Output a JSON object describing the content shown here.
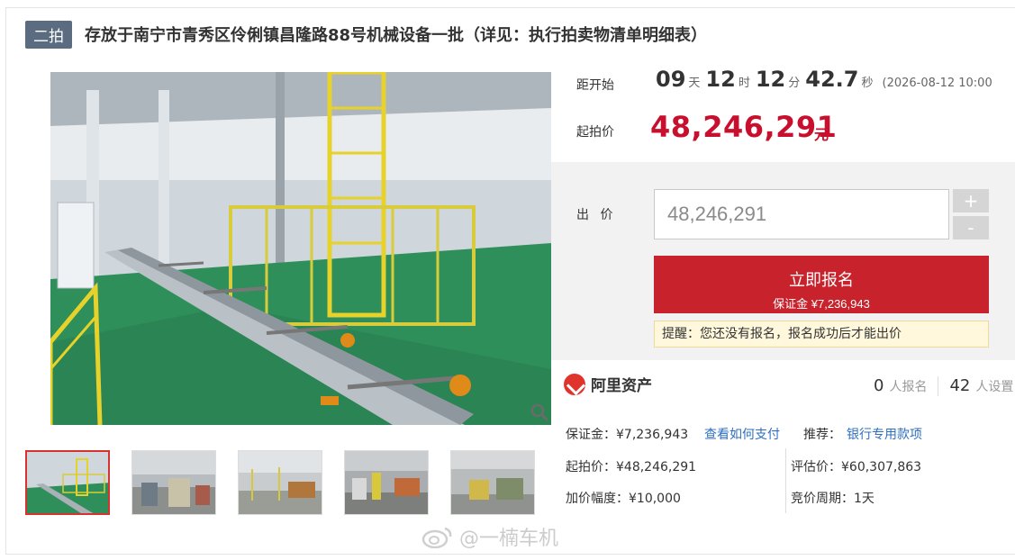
{
  "title": {
    "round_badge": "二拍",
    "text": "存放于南宁市青秀区伶俐镇昌隆路88号机械设备一批（详见：执行拍卖物清单明细表）"
  },
  "countdown": {
    "label": "距开始",
    "days": "09",
    "days_unit": "天",
    "hours": "12",
    "hours_unit": "时",
    "minutes": "12",
    "minutes_unit": "分",
    "seconds": "42.7",
    "seconds_unit": "秒",
    "start_datetime": "(2026-08-12 10:00"
  },
  "starting_price": {
    "label": "起拍价",
    "value": "48,246,291",
    "unit": "元"
  },
  "bid": {
    "label": "出 价",
    "input_value": "48,246,291",
    "plus": "+",
    "minus": "-",
    "signup_label": "立即报名",
    "deposit_label": "保证金 ¥7,236,943",
    "reminder": "提醒：您还没有报名，报名成功后才能出价"
  },
  "platform": {
    "name": "阿里资产",
    "signup_count": "0",
    "signup_unit": "人报名",
    "reminder_count": "42",
    "reminder_unit": "人设置"
  },
  "details": {
    "deposit_label": "保证金：¥7,236,943",
    "how_to_pay": "查看如何支付",
    "recommend_label": "推荐：",
    "recommend_value": "银行专用款项",
    "start_price_label": "起拍价：¥48,246,291",
    "appraisal_label": "评估价：¥60,307,863",
    "increment_label": "加价幅度：¥10,000",
    "cycle_label": "竞价周期：1天"
  },
  "watermark": "@一楠车机",
  "colors": {
    "accent_red": "#c8222c",
    "price_red": "#c8102e",
    "badge": "#5b6c80",
    "link": "#2f6fbf"
  },
  "icons": [
    "zoom-icon",
    "ali-logo-icon",
    "weibo-icon"
  ]
}
